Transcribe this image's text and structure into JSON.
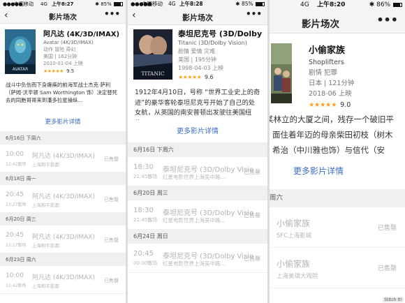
{
  "colors": {
    "accent": "#3a6fc4",
    "star": "#f5a623",
    "sold": "#b0b0b0"
  },
  "panels": [
    {
      "status": {
        "signal": "●●●●●",
        "carrier": "中国移动",
        "network": "4G",
        "time": "上午8:27",
        "battery": "85%",
        "battery_level": 0.85
      },
      "nav": {
        "back_icon": "‹",
        "title": "影片场次",
        "more_icon": "•••"
      },
      "movie": {
        "name": "阿凡达 (4K/3D/IMAX)",
        "english": "Avatar (4K/3D/IMAX)",
        "genre": "动作 冒险 奇幻",
        "meta": "美国 | 162分钟",
        "release": "2010-01-04 上映",
        "stars": "★★★★★",
        "score": "9.5",
        "poster_title": "AVATAR"
      },
      "synopsis": "战斗中负伤而下身瘫痪的前海军战士杰克·萨利（萨姆·沃辛顿 Sam Worthington 饰）决定替死去的同胞哥哥来到潘多拉星操纵...",
      "more_details": "更多影片详情",
      "groups": [
        {
          "date": "6月16日 下周六",
          "rows": [
            {
              "time": "10:00",
              "end": "12:42散场",
              "movie": "阿凡达 (4K/3D/IMAX)",
              "cinema": "上海和平影都",
              "status": "已售罄"
            }
          ]
        },
        {
          "date": "6月18日 周一",
          "rows": [
            {
              "time": "20:45",
              "end": "23:27散场",
              "movie": "阿凡达 (4K/3D/IMAX)",
              "cinema": "上海和平影都",
              "status": "已售罄"
            }
          ]
        },
        {
          "date": "6月20日 周三",
          "rows": [
            {
              "time": "20:45",
              "end": "23:27散场",
              "movie": "阿凡达 (4K/3D/IMAX)",
              "cinema": "上海和平影都",
              "status": "已售罄"
            }
          ]
        },
        {
          "date": "6月23日 周六",
          "rows": [
            {
              "time": "10:00",
              "end": "12:42散场",
              "movie": "阿凡达 (4K/3D/IMAX)",
              "cinema": "上海和平影都",
              "status": "已售罄"
            }
          ]
        }
      ]
    },
    {
      "status": {
        "signal": "●●●●●",
        "carrier": "中国移动",
        "network": "4G",
        "time": "上午8:28",
        "battery": "85%",
        "battery_level": 0.85
      },
      "nav": {
        "back_icon": "‹",
        "title": "影片场次",
        "more_icon": "•••"
      },
      "movie": {
        "name": "泰坦尼克号 (3D/Dolby Vision)",
        "english": "Titanic (3D/Dolby Vision)",
        "genre": "剧情 爱情 灾难",
        "meta": "美国 | 195分钟",
        "release": "1998-04-03 上映",
        "stars": "★★★★★",
        "score": "9.6",
        "poster_title": "TITANIC"
      },
      "synopsis": "1912年4月10日，号称 “世界工业史上的奇迹”的豪华客轮泰坦尼克号开始了自己的处女航，从英国的南安普顿出发驶往美国纽约...",
      "more_details": "更多影片详情",
      "groups": [
        {
          "date": "6月16日 下周六",
          "rows": [
            {
              "time": "18:30",
              "end": "21:45散场",
              "movie": "泰坦尼克号 (3D/Dolby Vision)",
              "cinema": "红星电影世界上海吴中路...",
              "status": "已售罄"
            }
          ]
        },
        {
          "date": "6月20日 周三",
          "rows": [
            {
              "time": "18:30",
              "end": "21:45散场",
              "movie": "泰坦尼克号 (3D/Dolby Vision)",
              "cinema": "红星电影世界上海吴中路...",
              "status": "已售罄"
            }
          ]
        },
        {
          "date": "6月24日 周日",
          "rows": [
            {
              "time": "20:45",
              "end": "00:00散场",
              "movie": "泰坦尼克号 (3D/Dolby Vision)",
              "cinema": "红星电影世界上海吴中路...",
              "status": "已售罄"
            }
          ]
        }
      ]
    },
    {
      "status": {
        "signal": "●●●●●",
        "carrier": "",
        "network": "4G",
        "time": "上午8:20",
        "battery": "86%",
        "battery_level": 0.86
      },
      "nav": {
        "back_icon": "",
        "title": "影片场次",
        "more_icon": "•••"
      },
      "movie": {
        "name": "小偷家族",
        "english": "Shoplifters",
        "genre": "剧情 犯罪",
        "meta": "日本 | 121分钟",
        "release": "2018-06 上映",
        "stars": "★★★★★",
        "score": "9.0",
        "poster_title": ""
      },
      "synopsis": "某林立的大厦之间，残存一个破旧平面住着年迈的母亲柴田初枝（树木希治（中川雅也饰）与信代（安藤...",
      "more_details": "更多影片详情",
      "groups": [
        {
          "date": "周六",
          "rows": [
            {
              "time": "",
              "end": "",
              "movie": "小偷家族",
              "cinema": "SFC上海影城",
              "status": "已售罄"
            },
            {
              "time": "",
              "end": "",
              "movie": "小偷家族",
              "cinema": "上海美琪大戏院",
              "status": "已售罄"
            }
          ]
        }
      ]
    }
  ],
  "footer": {
    "stitch": "Stitch It!"
  }
}
